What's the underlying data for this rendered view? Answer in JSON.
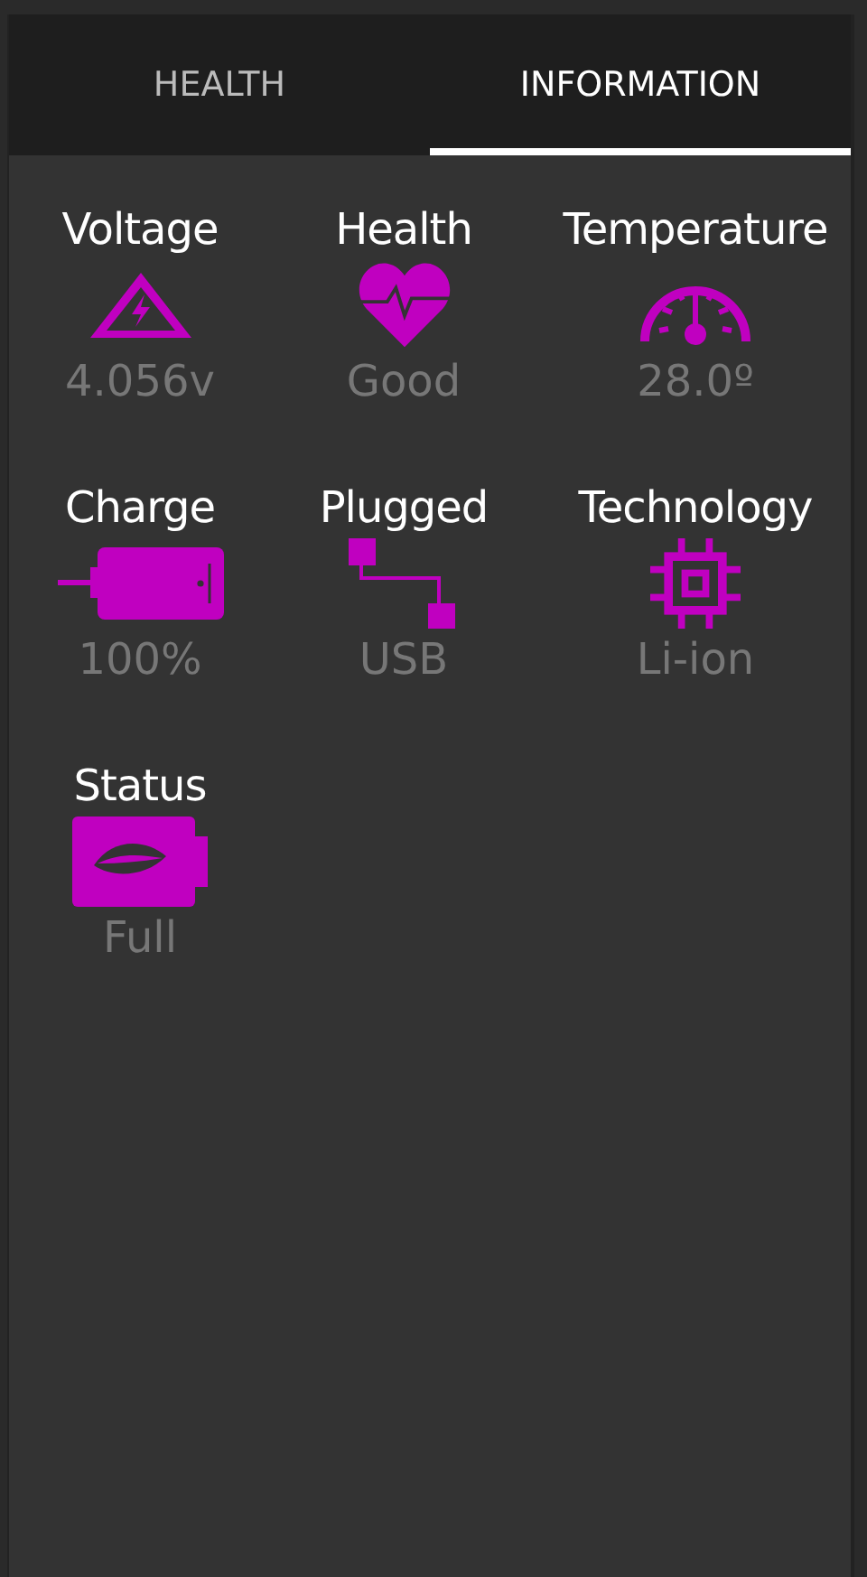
{
  "tabs": [
    {
      "label": "HEALTH",
      "selected": false
    },
    {
      "label": "INFORMATION",
      "selected": true
    }
  ],
  "items": [
    {
      "kind": "voltage",
      "label": "Voltage",
      "value": "4.056v"
    },
    {
      "kind": "health",
      "label": "Health",
      "value": "Good"
    },
    {
      "kind": "temperature",
      "label": "Temperature",
      "value": "28.0º"
    },
    {
      "kind": "charge",
      "label": "Charge",
      "value": "100%"
    },
    {
      "kind": "plugged",
      "label": "Plugged",
      "value": "USB"
    },
    {
      "kind": "technology",
      "label": "Technology",
      "value": "Li-ion"
    },
    {
      "kind": "status",
      "label": "Status",
      "value": "Full"
    }
  ]
}
